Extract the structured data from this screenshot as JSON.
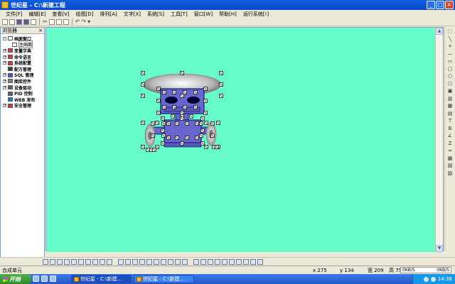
{
  "window": {
    "title": "世纪星 - C:\\新建工程"
  },
  "menu": [
    "文件[F]",
    "编辑[E]",
    "查看[V]",
    "绘图[D]",
    "排列[A]",
    "文字[X]",
    "系统[S]",
    "工具[T]",
    "窗口[W]",
    "帮助[H]",
    "运行系统[!]"
  ],
  "explorer": {
    "title": "浏览器",
    "close": "×",
    "items": [
      {
        "label": "画面窗口",
        "expander": "-",
        "icon": "window-icon",
        "color": "#ffffff",
        "child": false
      },
      {
        "label": "主画面",
        "expander": "",
        "icon": "page-icon",
        "color": "#ffffff",
        "child": true,
        "selected": true
      },
      {
        "label": "变量字典",
        "expander": "+",
        "icon": "dictionary-icon",
        "color": "#c84040",
        "child": false
      },
      {
        "label": "命令语言",
        "expander": "+",
        "icon": "command-icon",
        "color": "#c84040",
        "child": false
      },
      {
        "label": "系统配置",
        "expander": "+",
        "icon": "config-icon",
        "color": "#c84040",
        "child": false
      },
      {
        "label": "配方管理",
        "expander": "",
        "icon": "recipe-icon",
        "color": "#404040",
        "child": false
      },
      {
        "label": "SQL 管理",
        "expander": "+",
        "icon": "sql-icon",
        "color": "#4060c0",
        "child": false
      },
      {
        "label": "图库控件",
        "expander": "+",
        "icon": "library-icon",
        "color": "#808080",
        "child": false
      },
      {
        "label": "设备驱动",
        "expander": "+",
        "icon": "driver-icon",
        "color": "#606060",
        "child": false
      },
      {
        "label": "PID 控制",
        "expander": "",
        "icon": "pid-icon",
        "color": "#606060",
        "child": false
      },
      {
        "label": "WEB 发布",
        "expander": "",
        "icon": "web-icon",
        "color": "#2080c0",
        "child": false
      },
      {
        "label": "安全管理",
        "expander": "+",
        "icon": "security-icon",
        "color": "#c04040",
        "child": false
      }
    ]
  },
  "colors": {
    "canvas": "#66fdc8",
    "robot_body": "#6666cc",
    "robot_outline": "#000066",
    "dish": "#d0d0d0",
    "eye": "#000033"
  },
  "status": {
    "label": "合成单元",
    "x": "x 275",
    "y": "y 134",
    "width": "宽 209",
    "height": "高 75",
    "net_in": "0KB/S",
    "net_out": "0KB/S"
  },
  "taskbar": {
    "start": "开始",
    "tasks": [
      "世纪星 - C:\\新建...",
      "世纪星 - C:\\新建..."
    ],
    "clock": "14:38"
  }
}
